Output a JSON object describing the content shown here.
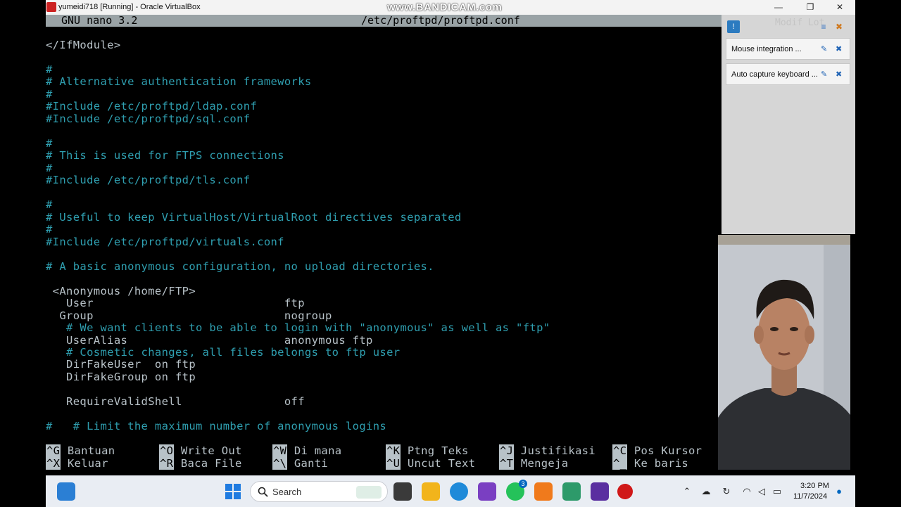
{
  "window": {
    "title": "yumeidi718 [Running] - Oracle VirtualBox",
    "watermark": "www.BANDICAM.com",
    "minimize": "—",
    "maximize": "❐",
    "close": "✕"
  },
  "nano": {
    "version": "GNU nano 3.2",
    "filename": "/etc/proftpd/proftpd.conf"
  },
  "editor_lines": [
    {
      "text": "</IfModule>",
      "type": "code"
    },
    {
      "text": "",
      "type": "code"
    },
    {
      "text": "#",
      "type": "comment"
    },
    {
      "text": "# Alternative authentication frameworks",
      "type": "comment"
    },
    {
      "text": "#",
      "type": "comment"
    },
    {
      "text": "#Include /etc/proftpd/ldap.conf",
      "type": "comment"
    },
    {
      "text": "#Include /etc/proftpd/sql.conf",
      "type": "comment"
    },
    {
      "text": "",
      "type": "code"
    },
    {
      "text": "#",
      "type": "comment"
    },
    {
      "text": "# This is used for FTPS connections",
      "type": "comment"
    },
    {
      "text": "#",
      "type": "comment"
    },
    {
      "text": "#Include /etc/proftpd/tls.conf",
      "type": "comment"
    },
    {
      "text": "",
      "type": "code"
    },
    {
      "text": "#",
      "type": "comment"
    },
    {
      "text": "# Useful to keep VirtualHost/VirtualRoot directives separated",
      "type": "comment"
    },
    {
      "text": "#",
      "type": "comment"
    },
    {
      "text": "#Include /etc/proftpd/virtuals.conf",
      "type": "comment"
    },
    {
      "text": "",
      "type": "code"
    },
    {
      "text": "# A basic anonymous configuration, no upload directories.",
      "type": "comment"
    },
    {
      "text": "",
      "type": "code"
    },
    {
      "text": " <Anonymous /home/FTP>",
      "type": "code"
    },
    {
      "text": "   User                            ftp",
      "type": "code"
    },
    {
      "text": "  Group                            nogroup",
      "type": "code"
    },
    {
      "text": "   # We want clients to be able to login with \"anonymous\" as well as \"ftp\"",
      "type": "comment"
    },
    {
      "text": "   UserAlias                       anonymous ftp",
      "type": "code"
    },
    {
      "text": "   # Cosmetic changes, all files belongs to ftp user",
      "type": "comment"
    },
    {
      "text": "   DirFakeUser  on ftp",
      "type": "code"
    },
    {
      "text": "   DirFakeGroup on ftp",
      "type": "code"
    },
    {
      "text": "",
      "type": "code"
    },
    {
      "text": "   RequireValidShell               off",
      "type": "code"
    },
    {
      "text": "",
      "type": "code"
    },
    {
      "text": "#   # Limit the maximum number of anonymous logins",
      "type": "comment"
    }
  ],
  "shortcuts": [
    {
      "key": "^G",
      "label": "Bantuan"
    },
    {
      "key": "^O",
      "label": "Write Out"
    },
    {
      "key": "^W",
      "label": "Di mana"
    },
    {
      "key": "^K",
      "label": "Ptng Teks"
    },
    {
      "key": "^J",
      "label": "Justifikasi"
    },
    {
      "key": "^C",
      "label": "Pos Kursor"
    },
    {
      "key": "^X",
      "label": "Keluar"
    },
    {
      "key": "^R",
      "label": "Baca File"
    },
    {
      "key": "^\\",
      "label": "Ganti"
    },
    {
      "key": "^U",
      "label": "Uncut Text"
    },
    {
      "key": "^T",
      "label": "Mengeja"
    },
    {
      "key": "^_",
      "label": "Ke baris"
    }
  ],
  "notifications": {
    "ghost_text": "Modif Lot",
    "items": [
      {
        "text": "Mouse integration ..."
      },
      {
        "text": "Auto capture keyboard ..."
      }
    ]
  },
  "taskbar": {
    "search_label": "Search",
    "whatsapp_badge": "3",
    "time": "3:20 PM",
    "date": "11/7/2024",
    "accent": "#0067c0"
  }
}
